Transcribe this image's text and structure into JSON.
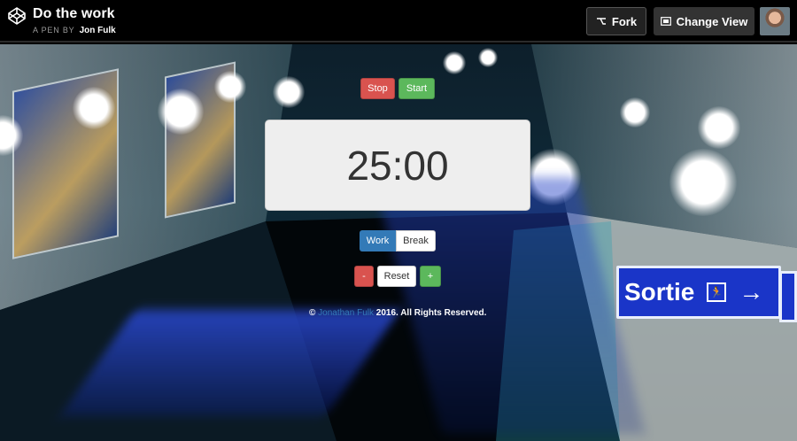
{
  "header": {
    "title": "Do the work",
    "pen_by": "A PEN BY",
    "author": "Jon Fulk",
    "fork_label": "Fork",
    "change_view_label": "Change View"
  },
  "app": {
    "stop_label": "Stop",
    "start_label": "Start",
    "timer": "25:00",
    "mode_work": "Work",
    "mode_break": "Break",
    "selected_mode": "Work",
    "minus_label": "-",
    "reset_label": "Reset",
    "plus_label": "+"
  },
  "footer": {
    "copyright_symbol": "©",
    "author_link": "Jonathan Fulk",
    "rest": " 2016. All Rights Reserved."
  },
  "background": {
    "sign_text": "Sortie",
    "sign_arrow": "→"
  },
  "colors": {
    "danger": "#d9534f",
    "success": "#5cb85c",
    "primary": "#337ab7",
    "sign_blue": "#1a35c8"
  },
  "icons": [
    "codepen-logo-icon",
    "fork-icon",
    "change-view-icon",
    "exit-person-icon",
    "arrow-right-icon"
  ]
}
